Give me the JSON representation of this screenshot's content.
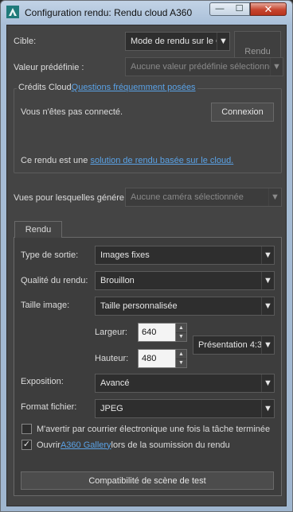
{
  "window": {
    "title": "Configuration rendu: Rendu cloud A360",
    "minimize_glyph": "—",
    "maximize_glyph": "☐",
    "close_glyph": "✕"
  },
  "target": {
    "label": "Cible:",
    "value": "Mode de rendu sur le C"
  },
  "render_button": {
    "label": "Rendu"
  },
  "preset": {
    "label": "Valeur prédéfinie :",
    "value": "Aucune valeur prédéfinie sélectionnée"
  },
  "cloud_credits": {
    "title": "Crédits Cloud",
    "faq_link": "Questions fréquemment posées",
    "status": "Vous n'êtes pas connecté.",
    "login_button": "Connexion",
    "info_prefix": "Ce rendu est une ",
    "info_link": "solution de rendu basée sur le cloud."
  },
  "views": {
    "label": "Vues pour lesquelles génére",
    "value": "Aucune caméra sélectionnée"
  },
  "tabs": [
    {
      "label": "Rendu"
    }
  ],
  "render_tab": {
    "output_type": {
      "label": "Type de sortie:",
      "value": "Images fixes"
    },
    "quality": {
      "label": "Qualité du rendu:",
      "value": "Brouillon"
    },
    "image_size": {
      "label": "Taille image:",
      "value": "Taille personnalisée"
    },
    "width": {
      "label": "Largeur:",
      "value": "640"
    },
    "height": {
      "label": "Hauteur:",
      "value": "480"
    },
    "aspect": {
      "value": "Présentation 4:3"
    },
    "exposure": {
      "label": "Exposition:",
      "value": "Avancé"
    },
    "file_format": {
      "label": "Format fichier:",
      "value": "JPEG"
    },
    "email_check": {
      "label": "M'avertir par courrier électronique une fois la tâche terminée",
      "checked": false
    },
    "gallery_check": {
      "prefix": "Ouvrir ",
      "link": "A360 Gallery",
      "suffix": " lors de la soumission du rendu",
      "checked": true,
      "mark": "✓"
    },
    "compat_button": "Compatibilité de scène de test"
  },
  "colors": {
    "panel": "#444444",
    "link": "#5aa2e6",
    "close_button": "#c6452f"
  }
}
